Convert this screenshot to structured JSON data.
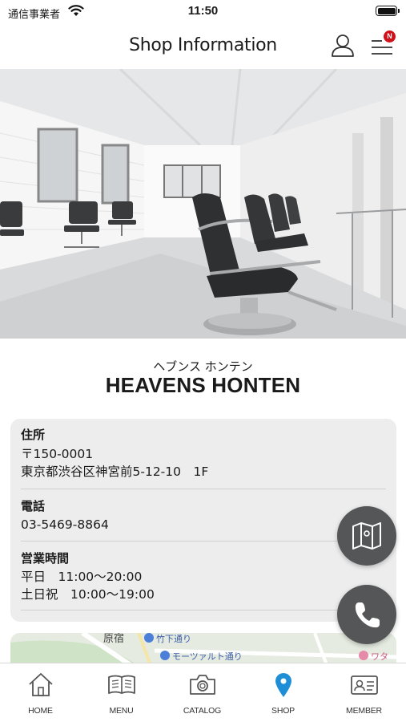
{
  "status_bar": {
    "carrier": "通信事業者",
    "time": "11:50"
  },
  "header": {
    "title": "Shop Information",
    "user_icon": "user-icon",
    "menu_icon": "hamburger-menu-icon",
    "notification_badge": "N"
  },
  "hero": {
    "image": "salon-interior-photo"
  },
  "shop": {
    "name_kana": "ヘブンス ホンテン",
    "name": "HEAVENS HONTEN"
  },
  "info": {
    "address": {
      "label": "住所",
      "postal": "〒150-0001",
      "line": "東京都渋谷区神宮前5-12-10　1F"
    },
    "phone": {
      "label": "電話",
      "number": "03-5469-8864"
    },
    "hours": {
      "label": "営業時間",
      "weekday": "平日　11:00〜20:00",
      "weekend": "土日祝　10:00〜19:00"
    }
  },
  "map": {
    "labels": [
      "原宿",
      "竹下通り",
      "モーツァルト通り",
      "ワタ"
    ]
  },
  "floating": {
    "map_icon": "map-icon",
    "call_icon": "phone-icon"
  },
  "tabs": [
    {
      "label": "HOME",
      "icon": "home-icon",
      "active": false
    },
    {
      "label": "MENU",
      "icon": "book-icon",
      "active": false
    },
    {
      "label": "CATALOG",
      "icon": "camera-icon",
      "active": false
    },
    {
      "label": "SHOP",
      "icon": "location-pin-icon",
      "active": true
    },
    {
      "label": "MEMBER",
      "icon": "member-card-icon",
      "active": false
    }
  ],
  "colors": {
    "accent": "#1e8fd6",
    "badge": "#d0111b",
    "fab": "#555658",
    "card": "#ededed"
  }
}
